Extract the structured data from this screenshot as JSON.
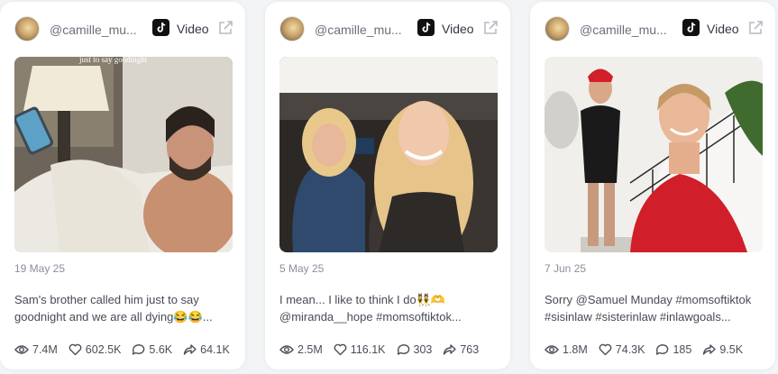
{
  "cards": [
    {
      "username": "@camille_mu...",
      "type_label": "Video",
      "overlay_text": "just to say goodnight",
      "date": "19 May 25",
      "caption_line1": "Sam's brother called him just to say",
      "caption_line2": "goodnight and we are all dying😂😂...",
      "stats": {
        "views": "7.4M",
        "likes": "602.5K",
        "comments": "5.6K",
        "shares": "64.1K"
      }
    },
    {
      "username": "@camille_mu...",
      "type_label": "Video",
      "date": "5 May 25",
      "caption_line1": "I mean... I like to think I do👯🫶",
      "caption_line2": "@miranda__hope #momsoftiktok...",
      "stats": {
        "views": "2.5M",
        "likes": "116.1K",
        "comments": "303",
        "shares": "763"
      }
    },
    {
      "username": "@camille_mu...",
      "type_label": "Video",
      "date": "7 Jun 25",
      "caption_line1": "Sorry @Samuel Munday #momsoftiktok",
      "caption_line2": "#sisinlaw #sisterinlaw #inlawgoals...",
      "stats": {
        "views": "1.8M",
        "likes": "74.3K",
        "comments": "185",
        "shares": "9.5K"
      }
    }
  ],
  "colors": {
    "card_bg": "#ffffff",
    "page_bg": "#f3f4f6",
    "text_muted": "#8a8f99",
    "tiktok_black": "#111111"
  },
  "icons": [
    "tiktok-icon",
    "external-link-icon",
    "eye-icon",
    "heart-icon",
    "comment-icon",
    "share-icon"
  ]
}
